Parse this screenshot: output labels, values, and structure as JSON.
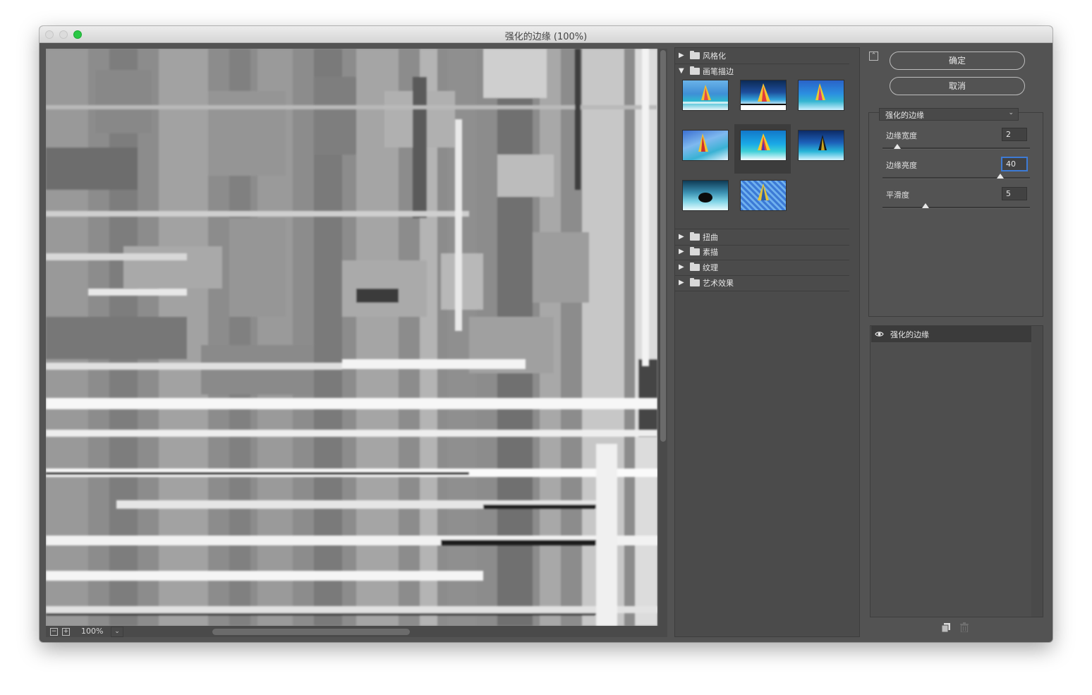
{
  "window": {
    "title": "强化的边缘 (100%)"
  },
  "preview": {
    "zoom": "100%",
    "zoom_out_symbol": "−",
    "zoom_in_symbol": "+",
    "dropdown_symbol": "⌄"
  },
  "gallery": {
    "categories": [
      {
        "label": "风格化",
        "expanded": false
      },
      {
        "label": "画笔描边",
        "expanded": true
      },
      {
        "label": "扭曲",
        "expanded": false
      },
      {
        "label": "素描",
        "expanded": false
      },
      {
        "label": "纹理",
        "expanded": false
      },
      {
        "label": "艺术效果",
        "expanded": false
      }
    ],
    "selected_thumbnail": 4
  },
  "buttons": {
    "ok": "确定",
    "cancel": "取消"
  },
  "filter": {
    "selected": "强化的边缘",
    "params": [
      {
        "label": "边缘宽度",
        "value": "2",
        "level": 0.1
      },
      {
        "label": "边缘亮度",
        "value": "40",
        "level": 0.8
      },
      {
        "label": "平滑度",
        "value": "5",
        "level": 0.29
      }
    ]
  },
  "layers": {
    "items": [
      {
        "label": "强化的边缘",
        "visible": true
      }
    ]
  },
  "colors": {
    "window_bg": "#535353",
    "panel_bg": "#4b4b4b",
    "selected_row": "#3b3b3b",
    "focus": "#3d7bd6",
    "close_zoom_green": "#2ac845"
  }
}
